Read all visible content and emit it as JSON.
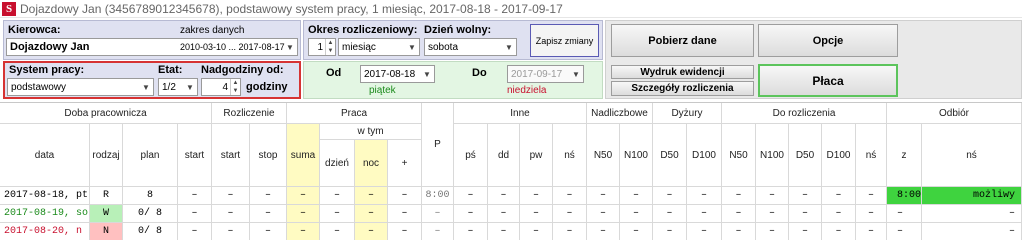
{
  "window": {
    "title": "Dojazdowy Jan (3456789012345678), podstawowy system pracy, 1 miesiąc, 2017-08-18 - 2017-09-17"
  },
  "kierowca": {
    "label": "Kierowca:",
    "zakres_label": "zakres danych",
    "selected": "Dojazdowy Jan",
    "zakres_value": "2010-03-10 ... 2017-08-17"
  },
  "system": {
    "system_label": "System pracy:",
    "etat_label": "Etat:",
    "nadgodziny_label": "Nadgodziny od:",
    "system_value": "podstawowy",
    "etat_value": "1/2",
    "nadgodziny_value": "4",
    "godziny_label": "godziny"
  },
  "okres": {
    "okres_label": "Okres rozliczeniowy:",
    "dzien_label": "Dzień wolny:",
    "okres_count": "1",
    "okres_unit": "miesiąc",
    "dzien_value": "sobota",
    "zapisz_label": "Zapisz zmiany"
  },
  "dates": {
    "od_label": "Od",
    "do_label": "Do",
    "od_value": "2017-08-18",
    "do_value": "2017-09-17",
    "od_day": "piątek",
    "do_day": "niedziela"
  },
  "buttons": {
    "pobierz": "Pobierz dane",
    "opcje": "Opcje",
    "wydruk": "Wydruk ewidencji",
    "szczegoly": "Szczegóły rozliczenia",
    "placa": "Płaca"
  },
  "table": {
    "groups": {
      "doba": "Doba pracownicza",
      "rozliczenie": "Rozliczenie",
      "praca": "Praca",
      "wtym": "w tym",
      "p": "P",
      "inne": "Inne",
      "nadliczbowe": "Nadliczbowe",
      "dyzury": "Dyżury",
      "dorozliczenia": "Do rozliczenia",
      "odbior": "Odbiór"
    },
    "columns": [
      "data",
      "rodzaj",
      "plan",
      "start",
      "start",
      "stop",
      "suma",
      "dzień",
      "noc",
      "+",
      "pś",
      "dd",
      "pw",
      "nś",
      "N50",
      "N100",
      "D50",
      "D100",
      "N50",
      "N100",
      "D50",
      "D100",
      "nś",
      "z",
      "nś"
    ],
    "rows": [
      [
        "2017-08-18, pt",
        "R",
        "8",
        "–",
        "–",
        "–",
        "–",
        "–",
        "–",
        "–",
        "8:00",
        "–",
        "–",
        "–",
        "–",
        "–",
        "–",
        "–",
        "–",
        "–",
        "–",
        "–",
        "–",
        "–",
        "8:00",
        "możliwy"
      ],
      [
        "2017-08-19, so",
        "W",
        "0/ 8",
        "–",
        "–",
        "–",
        "–",
        "–",
        "–",
        "–",
        "–",
        "–",
        "–",
        "–",
        "–",
        "–",
        "–",
        "–",
        "–",
        "–",
        "–",
        "–",
        "–",
        "–",
        "–",
        "–"
      ],
      [
        "2017-08-20, n",
        "N",
        "0/ 8",
        "–",
        "–",
        "–",
        "–",
        "–",
        "–",
        "–",
        "–",
        "–",
        "–",
        "–",
        "–",
        "–",
        "–",
        "–",
        "–",
        "–",
        "–",
        "–",
        "–",
        "–",
        "–",
        "–"
      ]
    ]
  },
  "colors": {
    "panel_blue": "#dfe1f1",
    "panel_green": "#e3f6e3",
    "highlight_red": "#d63333",
    "odbior_green": "#3fd33f",
    "yellow": "#fffbc2"
  }
}
